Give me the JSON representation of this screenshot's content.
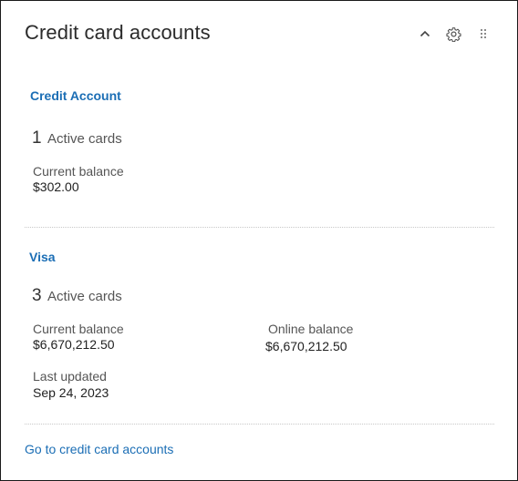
{
  "widget": {
    "title": "Credit card accounts",
    "footer_link": "Go to credit card accounts",
    "icons": [
      "chevron-up-icon",
      "gear-icon",
      "drag-handle-icon"
    ]
  },
  "accounts": [
    {
      "name": "Credit Account",
      "card_count": "1",
      "cards_label": "Active cards",
      "current_balance_label": "Current balance",
      "current_balance": "$302.00"
    },
    {
      "name": "Visa",
      "card_count": "3",
      "cards_label": "Active cards",
      "current_balance_label": "Current balance",
      "current_balance": "$6,670,212.50",
      "online_balance_label": "Online balance",
      "online_balance": "$6,670,212.50",
      "last_updated_label": "Last updated",
      "last_updated": "Sep 24, 2023"
    }
  ],
  "colors": {
    "link": "#1b6eb5",
    "text": "#333333",
    "border": "#1a1a1a"
  }
}
